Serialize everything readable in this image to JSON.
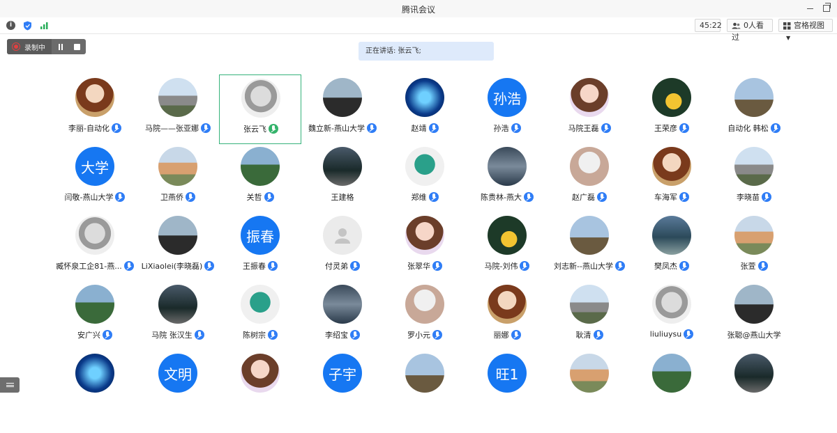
{
  "window": {
    "title": "腾讯会议"
  },
  "toolbar": {
    "timer": "45:22",
    "viewers": "0人看过",
    "view_mode": "宫格视图"
  },
  "recording": {
    "label": "录制中"
  },
  "banner": {
    "speaking": "正在讲话: 张云飞;"
  },
  "colors": {
    "accent": "#1677f2",
    "mic": "#2f7df6",
    "active_border": "#35b27a",
    "banner_bg": "#deeafb"
  },
  "participants": [
    {
      "name": "李丽-自动化",
      "avatar": "photo"
    },
    {
      "name": "马院——张亚娜",
      "avatar": "photo"
    },
    {
      "name": "张云飞",
      "avatar": "photo",
      "speaking": true
    },
    {
      "name": "魏立新-燕山大学",
      "avatar": "photo"
    },
    {
      "name": "赵靖",
      "avatar": "photo"
    },
    {
      "name": "孙浩",
      "avatar_text": "孙浩"
    },
    {
      "name": "马院王磊",
      "avatar": "photo"
    },
    {
      "name": "王荣彦",
      "avatar": "photo"
    },
    {
      "name": "自动化 韩松",
      "avatar": "photo"
    },
    {
      "name": "闫敬-燕山大学",
      "avatar_text": "大学"
    },
    {
      "name": "卫燕侨",
      "avatar": "photo"
    },
    {
      "name": "关哲",
      "avatar": "photo"
    },
    {
      "name": "王建格",
      "avatar": "photo",
      "no_mic": true
    },
    {
      "name": "郑维",
      "avatar": "photo"
    },
    {
      "name": "陈贵林-燕大",
      "avatar": "photo"
    },
    {
      "name": "赵广磊",
      "avatar": "photo"
    },
    {
      "name": "车海军",
      "avatar": "photo"
    },
    {
      "name": "李晓苗",
      "avatar": "photo"
    },
    {
      "name": "臧怀泉工企81-燕...",
      "avatar": "photo"
    },
    {
      "name": "LiXiaolei(李晓磊)",
      "avatar": "photo"
    },
    {
      "name": "王振春",
      "avatar_text": "振春"
    },
    {
      "name": "付灵弟",
      "avatar": "default"
    },
    {
      "name": "张翠华",
      "avatar": "photo"
    },
    {
      "name": "马院-刘伟",
      "avatar": "photo"
    },
    {
      "name": "刘志新--燕山大学",
      "avatar": "photo"
    },
    {
      "name": "樊凤杰",
      "avatar": "photo"
    },
    {
      "name": "张萱",
      "avatar": "photo"
    },
    {
      "name": "安广兴",
      "avatar": "photo"
    },
    {
      "name": "马院  张汉生",
      "avatar": "photo"
    },
    {
      "name": "陈树宗",
      "avatar": "photo"
    },
    {
      "name": "李绍宝",
      "avatar": "photo"
    },
    {
      "name": "罗小元",
      "avatar": "photo"
    },
    {
      "name": "丽娜",
      "avatar": "photo"
    },
    {
      "name": "耿清",
      "avatar": "photo"
    },
    {
      "name": "liuliuysu",
      "avatar": "photo"
    },
    {
      "name": "张聪@燕山大学",
      "avatar": "photo",
      "no_mic": true
    },
    {
      "name": "",
      "avatar": "photo"
    },
    {
      "name": "",
      "avatar_text": "文明"
    },
    {
      "name": "",
      "avatar": "photo"
    },
    {
      "name": "",
      "avatar_text": "子宇"
    },
    {
      "name": "",
      "avatar": "photo"
    },
    {
      "name": "",
      "avatar_text": "旺1"
    },
    {
      "name": "",
      "avatar": "photo"
    },
    {
      "name": "",
      "avatar": "photo"
    },
    {
      "name": "",
      "avatar": "photo"
    }
  ]
}
